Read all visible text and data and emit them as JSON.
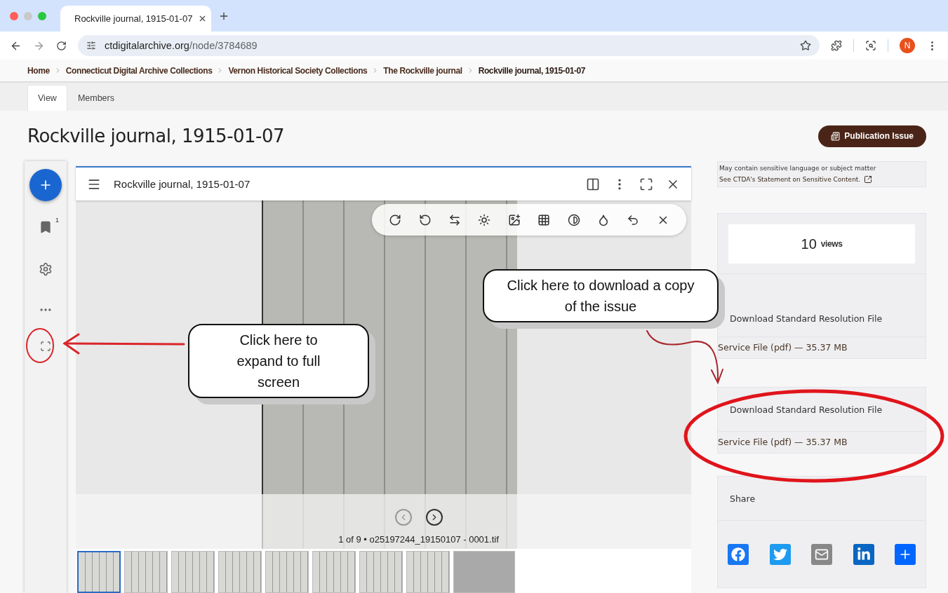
{
  "browser": {
    "tabs": [
      {
        "title": "Rockville journal, 1915-01-07",
        "selected": true
      }
    ],
    "url_host": "ctdigitalarchive.org",
    "url_path": "/node/3784689",
    "profile_initial": "N"
  },
  "breadcrumbs": [
    "Home",
    "Connecticut Digital Archive Collections",
    "Vernon Historical Society Collections",
    "The Rockville journal",
    "Rockville journal, 1915-01-07"
  ],
  "page_tabs": [
    {
      "label": "View",
      "selected": true
    },
    {
      "label": "Members",
      "selected": false
    }
  ],
  "title": "Rockville journal, 1915-01-07",
  "publication_button": "Publication Issue",
  "viewer": {
    "bookmark_count": "1",
    "title": "Rockville journal, 1915-01-07",
    "caption": "1 of 9 • o25197244_19150107 - 0001.tif",
    "thumbnails": [
      {
        "kind": "page",
        "selected": true
      },
      {
        "kind": "page",
        "selected": false
      },
      {
        "kind": "page",
        "selected": false
      },
      {
        "kind": "page",
        "selected": false
      },
      {
        "kind": "page",
        "selected": false
      },
      {
        "kind": "page",
        "selected": false
      },
      {
        "kind": "page",
        "selected": false
      },
      {
        "kind": "page",
        "selected": false
      },
      {
        "kind": "blank",
        "selected": false
      }
    ]
  },
  "sidebar": {
    "notice": {
      "line": "May contain sensitive language or subject matter",
      "link": "See CTDA's Statement on Sensitive Content."
    },
    "views_count": "10",
    "views_label": "views",
    "downloads": [
      {
        "title": "Download Standard Resolution File",
        "file": "Service File (pdf) — 35.37 MB"
      },
      {
        "title": "Download Standard Resolution File",
        "file": "Service File (pdf) — 35.37 MB"
      }
    ],
    "share": {
      "title": "Share",
      "buttons": [
        {
          "kind": "facebook",
          "color": "#1877f2"
        },
        {
          "kind": "twitter",
          "color": "#1d9bf0"
        },
        {
          "kind": "email",
          "color": "#888888"
        },
        {
          "kind": "linkedin",
          "color": "#0a66c2"
        },
        {
          "kind": "add",
          "color": "#0166ff"
        }
      ]
    }
  },
  "annotations": [
    {
      "text": "Click here to expand to full screen"
    },
    {
      "text": "Click here to download a copy of the issue"
    }
  ]
}
